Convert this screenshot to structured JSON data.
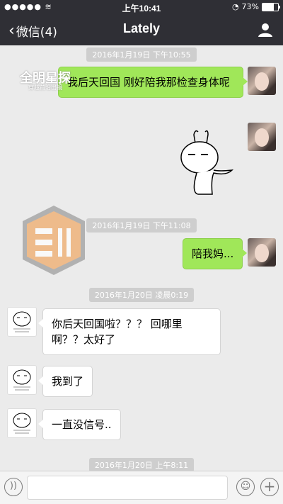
{
  "status": {
    "time": "上午10:41",
    "battery": "73%",
    "battery_level": 0.73
  },
  "nav": {
    "back_label": "微信(4)",
    "title": "Lately"
  },
  "timestamps": {
    "t1": "2016年1月19日 下午10:55",
    "t2": "2016年1月19日 下午11:08",
    "t3": "2016年1月20日 凌晨0:19",
    "t4": "2016年1月20日 上午8:11"
  },
  "messages": {
    "m1": "我后天回国 刚好陪我那检查身体呢",
    "m2": "陪我妈...",
    "m3": "你后天回国啦？？？ 回哪里啊？？太好了",
    "m4": "我到了",
    "m5": "一直没信号.."
  },
  "watermark": {
    "main": "全明星探",
    "sub": "穿越前沿出镜"
  },
  "icons": {
    "back": "chevron-left-icon",
    "profile": "person-icon",
    "voice": "voice-icon",
    "emoji": "emoji-icon",
    "add": "plus-icon"
  }
}
